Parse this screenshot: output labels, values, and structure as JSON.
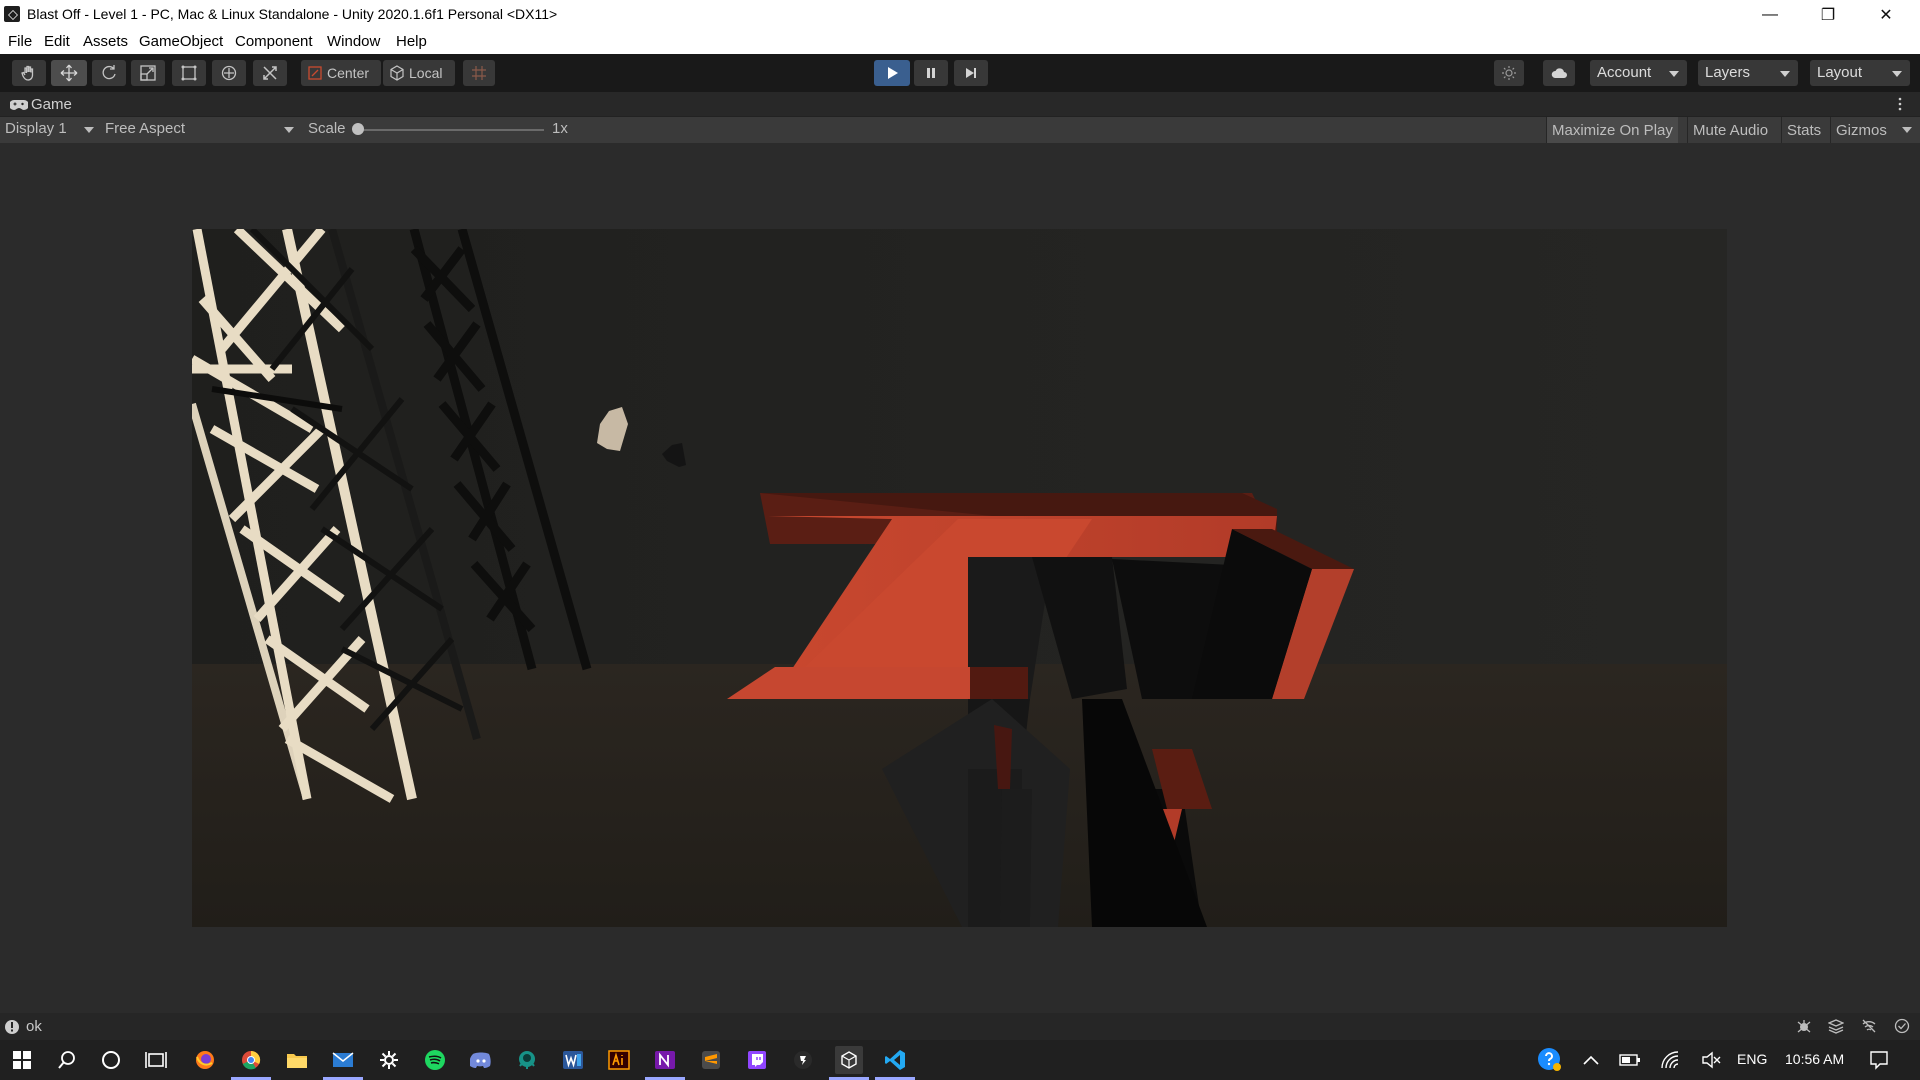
{
  "window": {
    "title": "Blast Off - Level 1 - PC, Mac & Linux Standalone - Unity 2020.1.6f1 Personal <DX11>",
    "minimize": "—",
    "maximize": "❐",
    "close": "✕"
  },
  "menu": [
    "File",
    "Edit",
    "Assets",
    "GameObject",
    "Component",
    "Window",
    "Help"
  ],
  "toolbar": {
    "pivot_label": "Center",
    "space_label": "Local",
    "account_label": "Account",
    "layers_label": "Layers",
    "layout_label": "Layout"
  },
  "game_tab": {
    "label": "Game"
  },
  "game_bar": {
    "display": "Display 1",
    "aspect": "Free Aspect",
    "scale_label": "Scale",
    "scale_value": "1x",
    "scale_fraction": 0.0,
    "maximize_on_play": "Maximize On Play",
    "mute_audio": "Mute Audio",
    "stats": "Stats",
    "gizmos": "Gizmos"
  },
  "status": {
    "message": "ok"
  },
  "taskbar": {
    "language": "ENG",
    "time": "10:56 AM"
  },
  "colors": {
    "accent_play": "#3a5f8f",
    "orange": "#c9482f",
    "tower": "#e8dcc4"
  }
}
